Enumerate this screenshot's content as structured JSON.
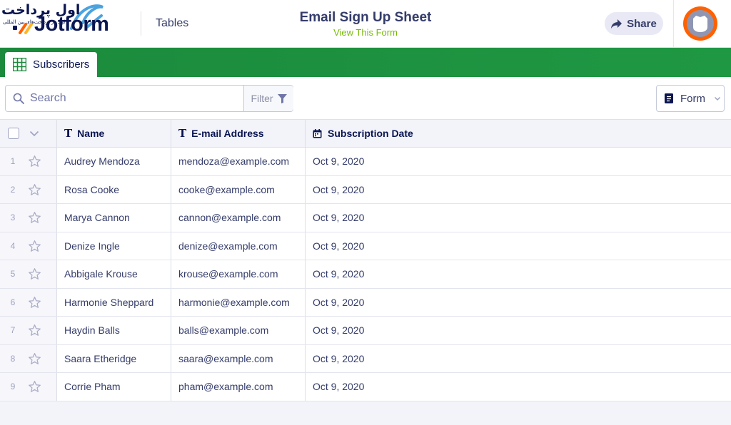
{
  "watermark": {
    "persian_title": "اول پرداخت",
    "persian_subtitle": "اول در پرداخت‌های بین المللی"
  },
  "app": {
    "brand": "Jotform",
    "nav_link": "Tables",
    "form_title": "Email Sign Up Sheet",
    "view_form": "View This Form",
    "share_label": "Share"
  },
  "tabs": [
    {
      "label": "Subscribers",
      "icon": "table-grid-icon",
      "active": true
    }
  ],
  "toolbar": {
    "search_placeholder": "Search",
    "filter_label": "Filter",
    "form_label": "Form"
  },
  "table": {
    "columns": [
      {
        "label": "Name",
        "icon": "text-type-icon"
      },
      {
        "label": "E-mail Address",
        "icon": "text-type-icon"
      },
      {
        "label": "Subscription Date",
        "icon": "calendar-icon"
      }
    ],
    "rows": [
      {
        "num": "1",
        "name": "Audrey Mendoza",
        "email": "mendoza@example.com",
        "date": "Oct 9, 2020"
      },
      {
        "num": "2",
        "name": "Rosa Cooke",
        "email": "cooke@example.com",
        "date": "Oct 9, 2020"
      },
      {
        "num": "3",
        "name": "Marya Cannon",
        "email": "cannon@example.com",
        "date": "Oct 9, 2020"
      },
      {
        "num": "4",
        "name": "Denize Ingle",
        "email": "denize@example.com",
        "date": "Oct 9, 2020"
      },
      {
        "num": "5",
        "name": "Abbigale Krouse",
        "email": "krouse@example.com",
        "date": "Oct 9, 2020"
      },
      {
        "num": "6",
        "name": "Harmonie Sheppard",
        "email": "harmonie@example.com",
        "date": "Oct 9, 2020"
      },
      {
        "num": "7",
        "name": "Haydin Balls",
        "email": "balls@example.com",
        "date": "Oct 9, 2020"
      },
      {
        "num": "8",
        "name": "Saara Etheridge",
        "email": "saara@example.com",
        "date": "Oct 9, 2020"
      },
      {
        "num": "9",
        "name": "Corrie Pham",
        "email": "pham@example.com",
        "date": "Oct 9, 2020"
      }
    ]
  },
  "colors": {
    "brand_navy": "#0a1551",
    "tab_green": "#1b8a3c",
    "link_green": "#78bb07",
    "avatar_orange": "#ff6100"
  }
}
